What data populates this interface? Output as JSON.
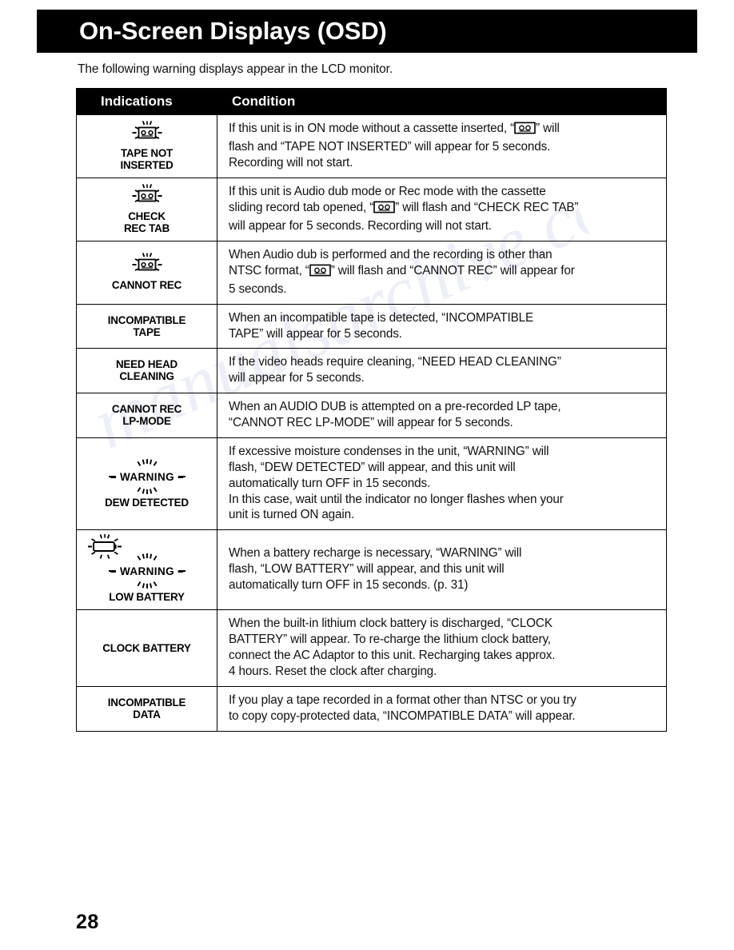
{
  "page": {
    "title": "On-Screen Displays (OSD)",
    "intro": "The following warning displays appear in the LCD monitor.",
    "number": "28",
    "watermark": "manualsarchive.com"
  },
  "table": {
    "headers": {
      "indications": "Indications",
      "condition": "Condition"
    },
    "rows": [
      {
        "icon": "cassette-flash-icon",
        "label_lines": [
          "TAPE NOT",
          "INSERTED"
        ],
        "condition_lines": [
          "If this unit is in ON mode without a cassette inserted, “",
          "” will",
          "flash and “TAPE NOT INSERTED” will appear for 5 seconds.",
          "Recording will not start."
        ]
      },
      {
        "icon": "cassette-flash-icon",
        "label_lines": [
          "CHECK",
          "REC TAB"
        ],
        "condition_lines": [
          "If this unit is Audio dub mode or Rec mode with the cassette",
          "sliding record tab opened, “",
          "” will flash and “CHECK REC TAB”",
          "will appear for 5 seconds. Recording will not start."
        ]
      },
      {
        "icon": "cassette-flash-icon",
        "label_lines": [
          "CANNOT REC"
        ],
        "condition_lines": [
          "When Audio dub is performed and the recording is other than",
          "NTSC format, “",
          "” will flash and “CANNOT REC” will appear for",
          "5 seconds."
        ]
      },
      {
        "icon": "none",
        "label_lines": [
          "INCOMPATIBLE",
          "TAPE"
        ],
        "condition_lines": [
          "When an incompatible tape is detected, “INCOMPATIBLE",
          "TAPE” will appear for 5 seconds."
        ]
      },
      {
        "icon": "none",
        "label_lines": [
          "NEED HEAD",
          "CLEANING"
        ],
        "condition_lines": [
          "If the video heads require cleaning, “NEED HEAD CLEANING”",
          "will appear for 5 seconds."
        ]
      },
      {
        "icon": "none",
        "label_lines": [
          "CANNOT REC",
          "LP-MODE"
        ],
        "condition_lines": [
          "When an AUDIO DUB is attempted on a pre-recorded LP tape,",
          "“CANNOT REC LP-MODE” will appear for 5 seconds."
        ]
      },
      {
        "icon": "warning-flash-icon",
        "icon_text": "– WARNING –",
        "label_lines": [
          "DEW DETECTED"
        ],
        "condition_lines": [
          "If excessive moisture condenses in the unit, “WARNING” will",
          "flash, “DEW DETECTED” will appear, and this unit will",
          "automatically turn OFF in 15 seconds.",
          "In this case, wait until the indicator no longer flashes when your",
          "unit is turned ON again."
        ]
      },
      {
        "icon": "battery-warning-flash-icon",
        "icon_text": "– WARNING –",
        "label_lines": [
          "LOW BATTERY"
        ],
        "condition_lines": [
          "When a battery recharge is necessary, “WARNING” will",
          "flash, “LOW BATTERY” will appear, and this unit will",
          "automatically turn OFF in 15 seconds. (p. 31)"
        ]
      },
      {
        "icon": "none",
        "label_lines": [
          "CLOCK BATTERY"
        ],
        "condition_lines": [
          "When the built-in lithium clock battery is discharged, “CLOCK",
          "BATTERY” will appear. To re-charge the lithium clock battery,",
          "connect the AC Adaptor to this unit. Recharging takes approx.",
          "4 hours. Reset the clock after charging."
        ]
      },
      {
        "icon": "none",
        "label_lines": [
          "INCOMPATIBLE",
          "DATA"
        ],
        "condition_lines": [
          "If you play a tape recorded in a format other than NTSC or you try",
          "to copy copy-protected data, “INCOMPATIBLE DATA” will appear."
        ]
      }
    ]
  },
  "colors": {
    "ink": "#000000",
    "paper": "#ffffff",
    "header_bg": "#000000",
    "header_fg": "#ffffff"
  }
}
